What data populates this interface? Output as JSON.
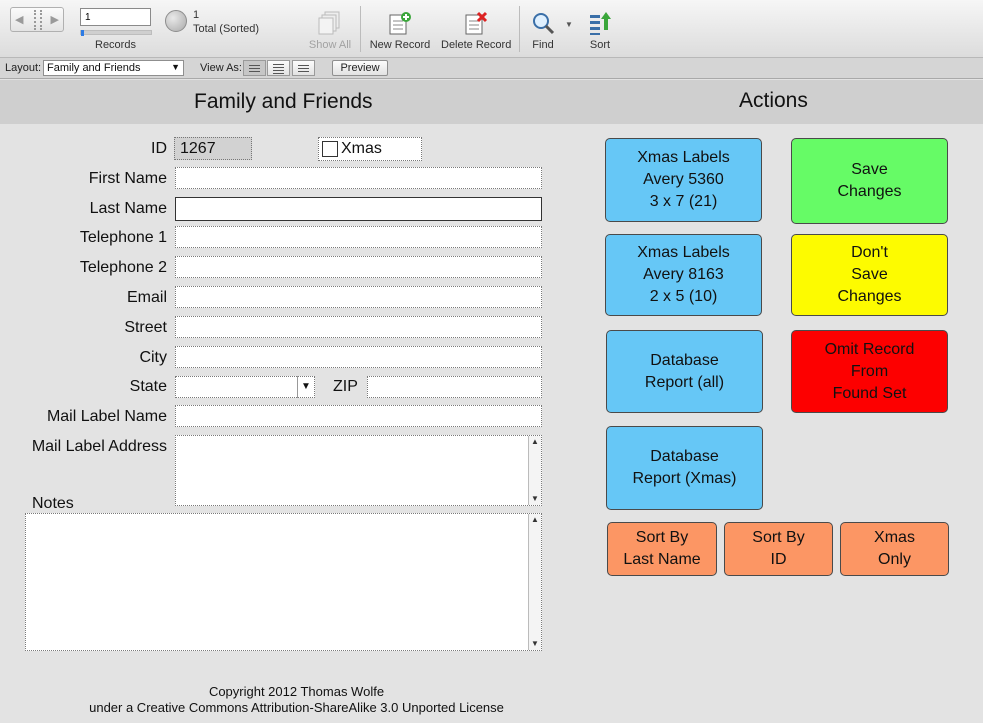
{
  "toolbar": {
    "record_value": "1",
    "records_label": "Records",
    "found_count": "1",
    "found_label": "Total (Sorted)",
    "show_all": "Show All",
    "new_record": "New Record",
    "delete_record": "Delete Record",
    "find": "Find",
    "sort": "Sort"
  },
  "layoutbar": {
    "layout_label": "Layout:",
    "layout_value": "Family and Friends",
    "view_as_label": "View As:",
    "preview": "Preview"
  },
  "form": {
    "title": "Family and Friends",
    "id_label": "ID",
    "id_value": "1267",
    "xmas_label": "Xmas",
    "first_name": "First Name",
    "last_name": "Last Name",
    "telephone1": "Telephone 1",
    "telephone2": "Telephone 2",
    "email": "Email",
    "street": "Street",
    "city": "City",
    "state": "State",
    "zip": "ZIP",
    "mail_label_name": "Mail Label Name",
    "mail_label_address": "Mail Label Address",
    "notes": "Notes"
  },
  "actions": {
    "title": "Actions",
    "xmas_labels_5360": "Xmas Labels\nAvery 5360\n3 x 7 (21)",
    "xmas_labels_8163": "Xmas Labels\nAvery 8163\n2 x 5 (10)",
    "db_report_all": "Database\nReport (all)",
    "db_report_xmas": "Database\nReport (Xmas)",
    "save_changes": "Save\nChanges",
    "dont_save": "Don't\nSave\nChanges",
    "omit_record": "Omit Record\nFrom\nFound Set",
    "sort_last_name": "Sort By\nLast Name",
    "sort_id": "Sort By\nID",
    "xmas_only": "Xmas\nOnly"
  },
  "footer": {
    "line1": "Copyright 2012 Thomas Wolfe",
    "line2": "under a Creative Commons Attribution-ShareAlike 3.0 Unported License"
  },
  "colors": {
    "blue": "#66c7f6",
    "green": "#66fb66",
    "yellow": "#fdfb00",
    "red": "#fd0000",
    "orange": "#fc9664"
  }
}
